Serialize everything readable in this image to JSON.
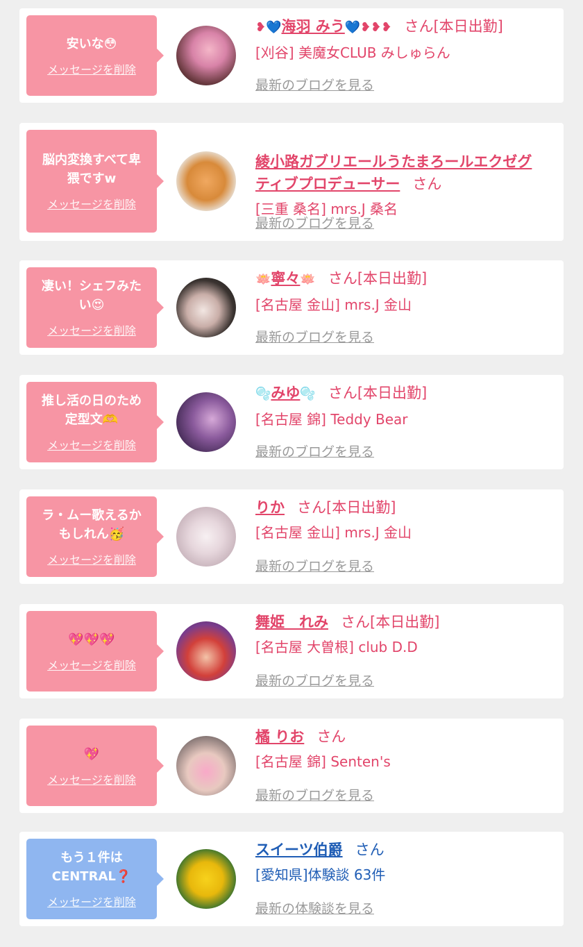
{
  "delete_label": "メッセージを削除",
  "san_label": "さん",
  "items": [
    {
      "bubble_text": "安いな😳",
      "name_prefix": "❥💙",
      "name": "海羽 みう",
      "name_suffix": "💙❥❥❥",
      "san_suffix": "さん[本日出勤]",
      "shop": "[刈谷] 美魔女CLUB みしゅらん",
      "blog_label": "最新のブログを見る"
    },
    {
      "bubble_text": "脳内変換すべて卑\n猥ですw",
      "name": "綾小路ガブリエールうたまろールエクゼグ\nティブプロデューサー",
      "san_suffix": "さん",
      "shop": "[三重 桑名] mrs.J 桑名",
      "blog_label": "最新のブログを見る"
    },
    {
      "bubble_text": "凄い！シェフみた\nい😍",
      "name_prefix": "🪷",
      "name": "寧々",
      "name_suffix": "🪷",
      "san_suffix": "さん[本日出勤]",
      "shop": "[名古屋 金山] mrs.J 金山",
      "blog_label": "最新のブログを見る"
    },
    {
      "bubble_text": "推し活の日のため\n定型文🫶",
      "name_prefix": "🫧",
      "name": "みゆ",
      "name_suffix": "🫧",
      "san_suffix": "さん[本日出勤]",
      "shop": "[名古屋 錦] Teddy Bear",
      "blog_label": "最新のブログを見る"
    },
    {
      "bubble_text": "ラ・ムー歌えるか\nもしれん🥳",
      "name": "りか",
      "san_suffix": "さん[本日出勤]",
      "shop": "[名古屋 金山] mrs.J 金山",
      "blog_label": "最新のブログを見る"
    },
    {
      "bubble_text": "💖💖💖",
      "name": "舞姫　れみ",
      "san_suffix": "さん[本日出勤]",
      "shop": "[名古屋 大曽根] club D.D",
      "blog_label": "最新のブログを見る"
    },
    {
      "bubble_text": "💖",
      "name": "橘 りお",
      "san_suffix": "さん",
      "shop": "[名古屋 錦] Senten's",
      "blog_label": "最新のブログを見る"
    },
    {
      "bubble_text": "もう１件は\nCENTRAL❓",
      "name": "スイーツ伯爵",
      "san_suffix": "さん",
      "shop": "[愛知県]体験談 63件",
      "blog_label": "最新の体験談を見る"
    }
  ],
  "colors": {
    "background": "#efefef",
    "card": "#ffffff",
    "pink_bubble": "#f795a4",
    "blue_bubble": "#8fb6f0",
    "pink_text": "#e2456a",
    "blue_text": "#1f5db5",
    "gray_link": "#9a9a9a"
  }
}
